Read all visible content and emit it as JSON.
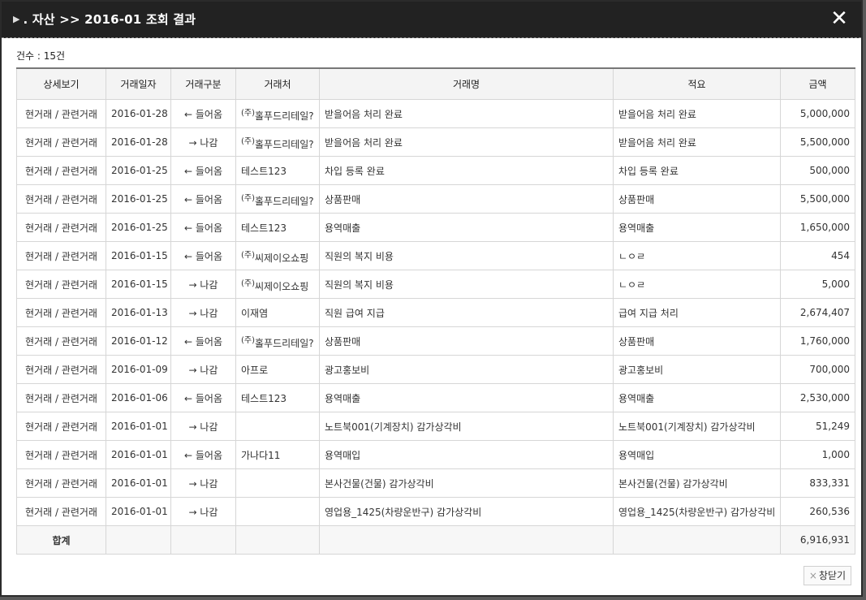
{
  "window": {
    "title": ". 자산 >> 2016-01 조회 결과",
    "close_symbol": "✕"
  },
  "summary": {
    "count_label": "건수 : 15건"
  },
  "table": {
    "headers": [
      "상세보기",
      "거래일자",
      "거래구분",
      "거래처",
      "거래명",
      "적요",
      "금액"
    ],
    "rows": [
      {
        "detail": "현거래 / 관련거래",
        "date": "2016-01-28",
        "type": "← 들어옴",
        "dir": "in",
        "vendor_sup": "(주)",
        "vendor": "홀푸드리테일?",
        "name": "받을어음 처리 완료",
        "memo": "받을어음 처리 완료",
        "amount": "5,000,000"
      },
      {
        "detail": "현거래 / 관련거래",
        "date": "2016-01-28",
        "type": "→ 나감",
        "dir": "out",
        "vendor_sup": "(주)",
        "vendor": "홀푸드리테일?",
        "name": "받을어음 처리 완료",
        "memo": "받을어음 처리 완료",
        "amount": "5,500,000"
      },
      {
        "detail": "현거래 / 관련거래",
        "date": "2016-01-25",
        "type": "← 들어옴",
        "dir": "in",
        "vendor_sup": "",
        "vendor": "테스트123",
        "name": "차입 등록 완료",
        "memo": "차입 등록 완료",
        "amount": "500,000"
      },
      {
        "detail": "현거래 / 관련거래",
        "date": "2016-01-25",
        "type": "← 들어옴",
        "dir": "in",
        "vendor_sup": "(주)",
        "vendor": "홀푸드리테일?",
        "name": "상품판매",
        "memo": "상품판매",
        "amount": "5,500,000"
      },
      {
        "detail": "현거래 / 관련거래",
        "date": "2016-01-25",
        "type": "← 들어옴",
        "dir": "in",
        "vendor_sup": "",
        "vendor": "테스트123",
        "name": "용역매출",
        "memo": "용역매출",
        "amount": "1,650,000"
      },
      {
        "detail": "현거래 / 관련거래",
        "date": "2016-01-15",
        "type": "← 들어옴",
        "dir": "in",
        "vendor_sup": "(주)",
        "vendor": "씨제이오쇼핑",
        "name": "직원의 복지 비용",
        "memo": "ㄴㅇㄹ",
        "amount": "454"
      },
      {
        "detail": "현거래 / 관련거래",
        "date": "2016-01-15",
        "type": "→ 나감",
        "dir": "out",
        "vendor_sup": "(주)",
        "vendor": "씨제이오쇼핑",
        "name": "직원의 복지 비용",
        "memo": "ㄴㅇㄹ",
        "amount": "5,000"
      },
      {
        "detail": "현거래 / 관련거래",
        "date": "2016-01-13",
        "type": "→ 나감",
        "dir": "out",
        "vendor_sup": "",
        "vendor": "이재염",
        "name": "직원 급여 지급",
        "memo": "급여 지급 처리",
        "amount": "2,674,407"
      },
      {
        "detail": "현거래 / 관련거래",
        "date": "2016-01-12",
        "type": "← 들어옴",
        "dir": "in",
        "vendor_sup": "(주)",
        "vendor": "홀푸드리테일?",
        "name": "상품판매",
        "memo": "상품판매",
        "amount": "1,760,000"
      },
      {
        "detail": "현거래 / 관련거래",
        "date": "2016-01-09",
        "type": "→ 나감",
        "dir": "out",
        "vendor_sup": "",
        "vendor": "아프로",
        "name": "광고홍보비",
        "memo": "광고홍보비",
        "amount": "700,000"
      },
      {
        "detail": "현거래 / 관련거래",
        "date": "2016-01-06",
        "type": "← 들어옴",
        "dir": "in",
        "vendor_sup": "",
        "vendor": "테스트123",
        "name": "용역매출",
        "memo": "용역매출",
        "amount": "2,530,000"
      },
      {
        "detail": "현거래 / 관련거래",
        "date": "2016-01-01",
        "type": "→ 나감",
        "dir": "out",
        "vendor_sup": "",
        "vendor": "",
        "name": "노트북001(기계장치) 감가상각비",
        "memo": "노트북001(기계장치) 감가상각비",
        "amount": "51,249"
      },
      {
        "detail": "현거래 / 관련거래",
        "date": "2016-01-01",
        "type": "← 들어옴",
        "dir": "in",
        "vendor_sup": "",
        "vendor": "가나다11",
        "name": "용역매입",
        "memo": "용역매입",
        "amount": "1,000"
      },
      {
        "detail": "현거래 / 관련거래",
        "date": "2016-01-01",
        "type": "→ 나감",
        "dir": "out",
        "vendor_sup": "",
        "vendor": "",
        "name": "본사건물(건물) 감가상각비",
        "memo": "본사건물(건물) 감가상각비",
        "amount": "833,331"
      },
      {
        "detail": "현거래 / 관련거래",
        "date": "2016-01-01",
        "type": "→ 나감",
        "dir": "out",
        "vendor_sup": "",
        "vendor": "",
        "name": "영업용_1425(차량운반구) 감가상각비",
        "memo": "영업용_1425(차량운반구) 감가상각비",
        "amount": "260,536"
      }
    ],
    "total_label": "합계",
    "total_amount": "6,916,931"
  },
  "footer": {
    "close_button_label": "창닫기",
    "close_button_icon": "×"
  },
  "colors": {
    "in": "#2e8b2e",
    "out": "#e02020",
    "titlebar": "#222222"
  }
}
